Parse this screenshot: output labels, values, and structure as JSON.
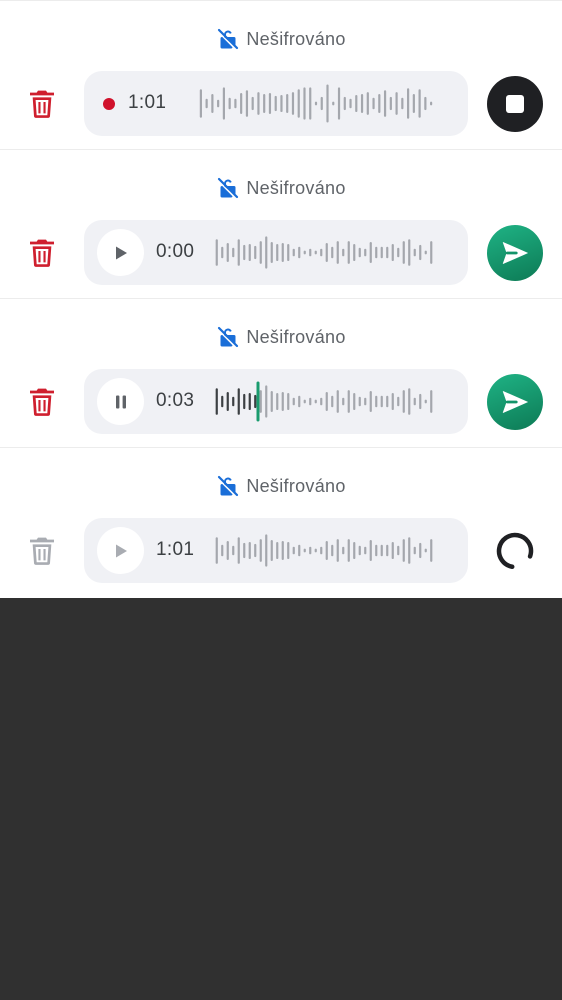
{
  "rows": [
    {
      "status": "Nešifrováno",
      "mode": "recording",
      "time": "1:01",
      "action": "stop",
      "delete_enabled": true
    },
    {
      "status": "Nešifrováno",
      "mode": "paused",
      "time": "0:00",
      "action": "send",
      "delete_enabled": true,
      "progress": 0
    },
    {
      "status": "Nešifrováno",
      "mode": "playing",
      "time": "0:03",
      "action": "send",
      "delete_enabled": true,
      "progress": 0.2
    },
    {
      "status": "Nešifrováno",
      "mode": "disabled",
      "time": "1:01",
      "action": "loading",
      "delete_enabled": false,
      "progress": 0
    }
  ],
  "colors": {
    "delete_active": "#cf1f2e",
    "delete_disabled": "#a9acb2",
    "lock": "#1a6ed8",
    "wave": "#a4a7ad",
    "wave_played": "#3c4043",
    "playhead": "#1a9c6e",
    "recording_dot": "#d0112b"
  },
  "icons": {
    "status": "lock-off-icon",
    "delete": "trash-icon",
    "play": "play-icon",
    "pause": "pause-icon",
    "stop": "stop-icon",
    "send": "send-icon",
    "loading": "spinner-icon"
  }
}
